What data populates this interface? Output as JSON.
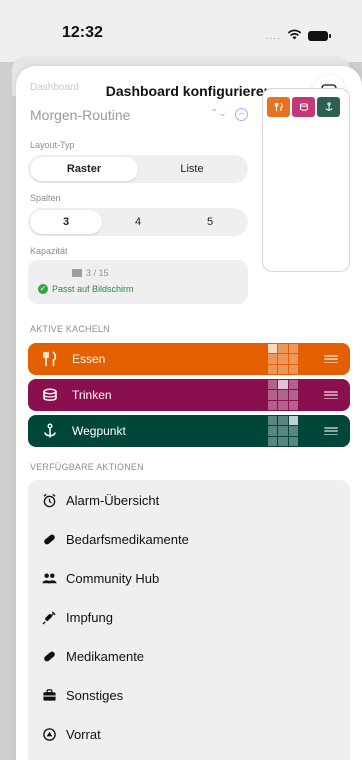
{
  "status_bar": {
    "time": "12:32",
    "signal_dots": "....",
    "wifi_icon": "wifi-icon",
    "battery_icon": "battery-icon"
  },
  "sheet": {
    "title": "Dashboard konfigurieren",
    "reorder_icon": "arrows-up-down-icon",
    "faded_label": "Dashboard",
    "profile": {
      "name": "Morgen-Routine",
      "chevron": "⌃⌄",
      "remove_symbol": "−"
    }
  },
  "layout": {
    "label": "Layout-Typ",
    "options": [
      "Raster",
      "Liste"
    ],
    "selected": "Raster"
  },
  "columns": {
    "label": "Spalten",
    "options": [
      "3",
      "4",
      "5"
    ],
    "selected": "3"
  },
  "capacity": {
    "label": "Kapazität",
    "value": "3 / 15",
    "fit_text": "Passt auf Bildschirm"
  },
  "preview": {
    "tiles": [
      {
        "name": "Essen",
        "color": "#e8731e",
        "icon": "fork-knife-icon"
      },
      {
        "name": "Trinken",
        "color": "#c2397a",
        "icon": "cup-icon"
      },
      {
        "name": "Wegpunkt",
        "color": "#2f5e52",
        "icon": "anchor-icon"
      }
    ]
  },
  "active_tiles": {
    "header": "AKTIVE KACHELN",
    "items": [
      {
        "label": "Essen",
        "color": "#e35f00",
        "icon": "fork-knife-icon"
      },
      {
        "label": "Trinken",
        "color": "#8a0f4e",
        "icon": "cup-icon"
      },
      {
        "label": "Wegpunkt",
        "color": "#00463a",
        "icon": "anchor-icon"
      }
    ]
  },
  "available_actions": {
    "header": "VERFÜGBARE AKTIONEN",
    "items": [
      {
        "label": "Alarm-Übersicht",
        "icon": "alarm-clock-icon"
      },
      {
        "label": "Bedarfsmedikamente",
        "icon": "pill-icon"
      },
      {
        "label": "Community Hub",
        "icon": "people-icon"
      },
      {
        "label": "Impfung",
        "icon": "syringe-icon"
      },
      {
        "label": "Medikamente",
        "icon": "pill-icon"
      },
      {
        "label": "Sonstiges",
        "icon": "toolbox-icon"
      },
      {
        "label": "Vorrat",
        "icon": "supply-icon"
      }
    ]
  }
}
